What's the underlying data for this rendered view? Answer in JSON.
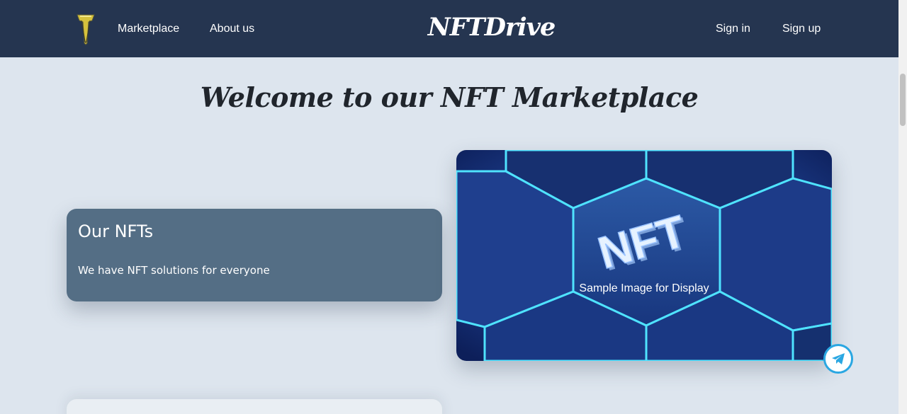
{
  "header": {
    "logo_icon": "car-emblem-logo",
    "nav_links": [
      "Marketplace",
      "About us"
    ],
    "brand": "NFTDrive",
    "auth_links": [
      "Sign in",
      "Sign up"
    ]
  },
  "hero": {
    "headline": "Welcome to our NFT Marketplace"
  },
  "card": {
    "title": "Our NFTs",
    "text": "We have NFT solutions for everyone"
  },
  "image": {
    "nft_text": "NFT",
    "caption": "Sample Image for Display"
  },
  "floating": {
    "icon": "telegram-icon"
  },
  "colors": {
    "navbar": "#253550",
    "background": "#dde5ee",
    "card": "#546e85",
    "telegram": "#2aa7e2"
  }
}
